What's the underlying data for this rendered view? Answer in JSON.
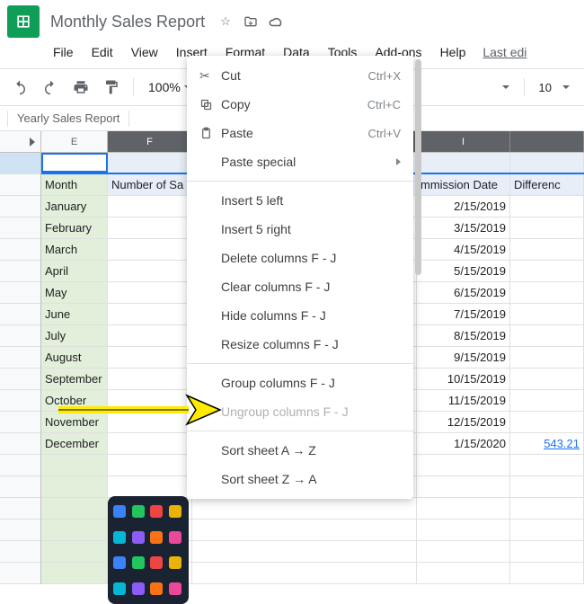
{
  "doc_title": "Monthly Sales Report",
  "menubar": [
    "File",
    "Edit",
    "View",
    "Insert",
    "Format",
    "Data",
    "Tools",
    "Add-ons",
    "Help"
  ],
  "last_edit": "Last edi",
  "zoom": "100%",
  "font_size": "10",
  "sheet_tab": "Yearly Sales Report",
  "columns": {
    "e": "E",
    "f": "F",
    "i": "I"
  },
  "header_row": {
    "e": "Month",
    "f": "Number of Sa",
    "i": "mmission Date",
    "j": "Differenc"
  },
  "rows": [
    {
      "e": "January",
      "i": "2/15/2019"
    },
    {
      "e": "February",
      "i": "3/15/2019"
    },
    {
      "e": "March",
      "i": "4/15/2019"
    },
    {
      "e": "April",
      "i": "5/15/2019"
    },
    {
      "e": "May",
      "i": "6/15/2019"
    },
    {
      "e": "June",
      "i": "7/15/2019"
    },
    {
      "e": "July",
      "i": "8/15/2019"
    },
    {
      "e": "August",
      "i": "9/15/2019"
    },
    {
      "e": "September",
      "i": "10/15/2019"
    },
    {
      "e": "October",
      "i": "11/15/2019"
    },
    {
      "e": "November",
      "i": "12/15/2019"
    },
    {
      "e": "December",
      "i": "1/15/2020",
      "j": "543.21"
    }
  ],
  "context_menu": {
    "cut": {
      "label": "Cut",
      "shortcut": "Ctrl+X"
    },
    "copy": {
      "label": "Copy",
      "shortcut": "Ctrl+C"
    },
    "paste": {
      "label": "Paste",
      "shortcut": "Ctrl+V"
    },
    "paste_special": "Paste special",
    "insert_left": "Insert 5 left",
    "insert_right": "Insert 5 right",
    "delete_cols": "Delete columns F - J",
    "clear_cols": "Clear columns F - J",
    "hide_cols": "Hide columns F - J",
    "resize_cols": "Resize columns F - J",
    "group_cols": "Group columns F - J",
    "ungroup_cols": "Ungroup columns F - J",
    "sort_az": "Sort sheet A → Z",
    "sort_za": "Sort sheet Z → A"
  }
}
